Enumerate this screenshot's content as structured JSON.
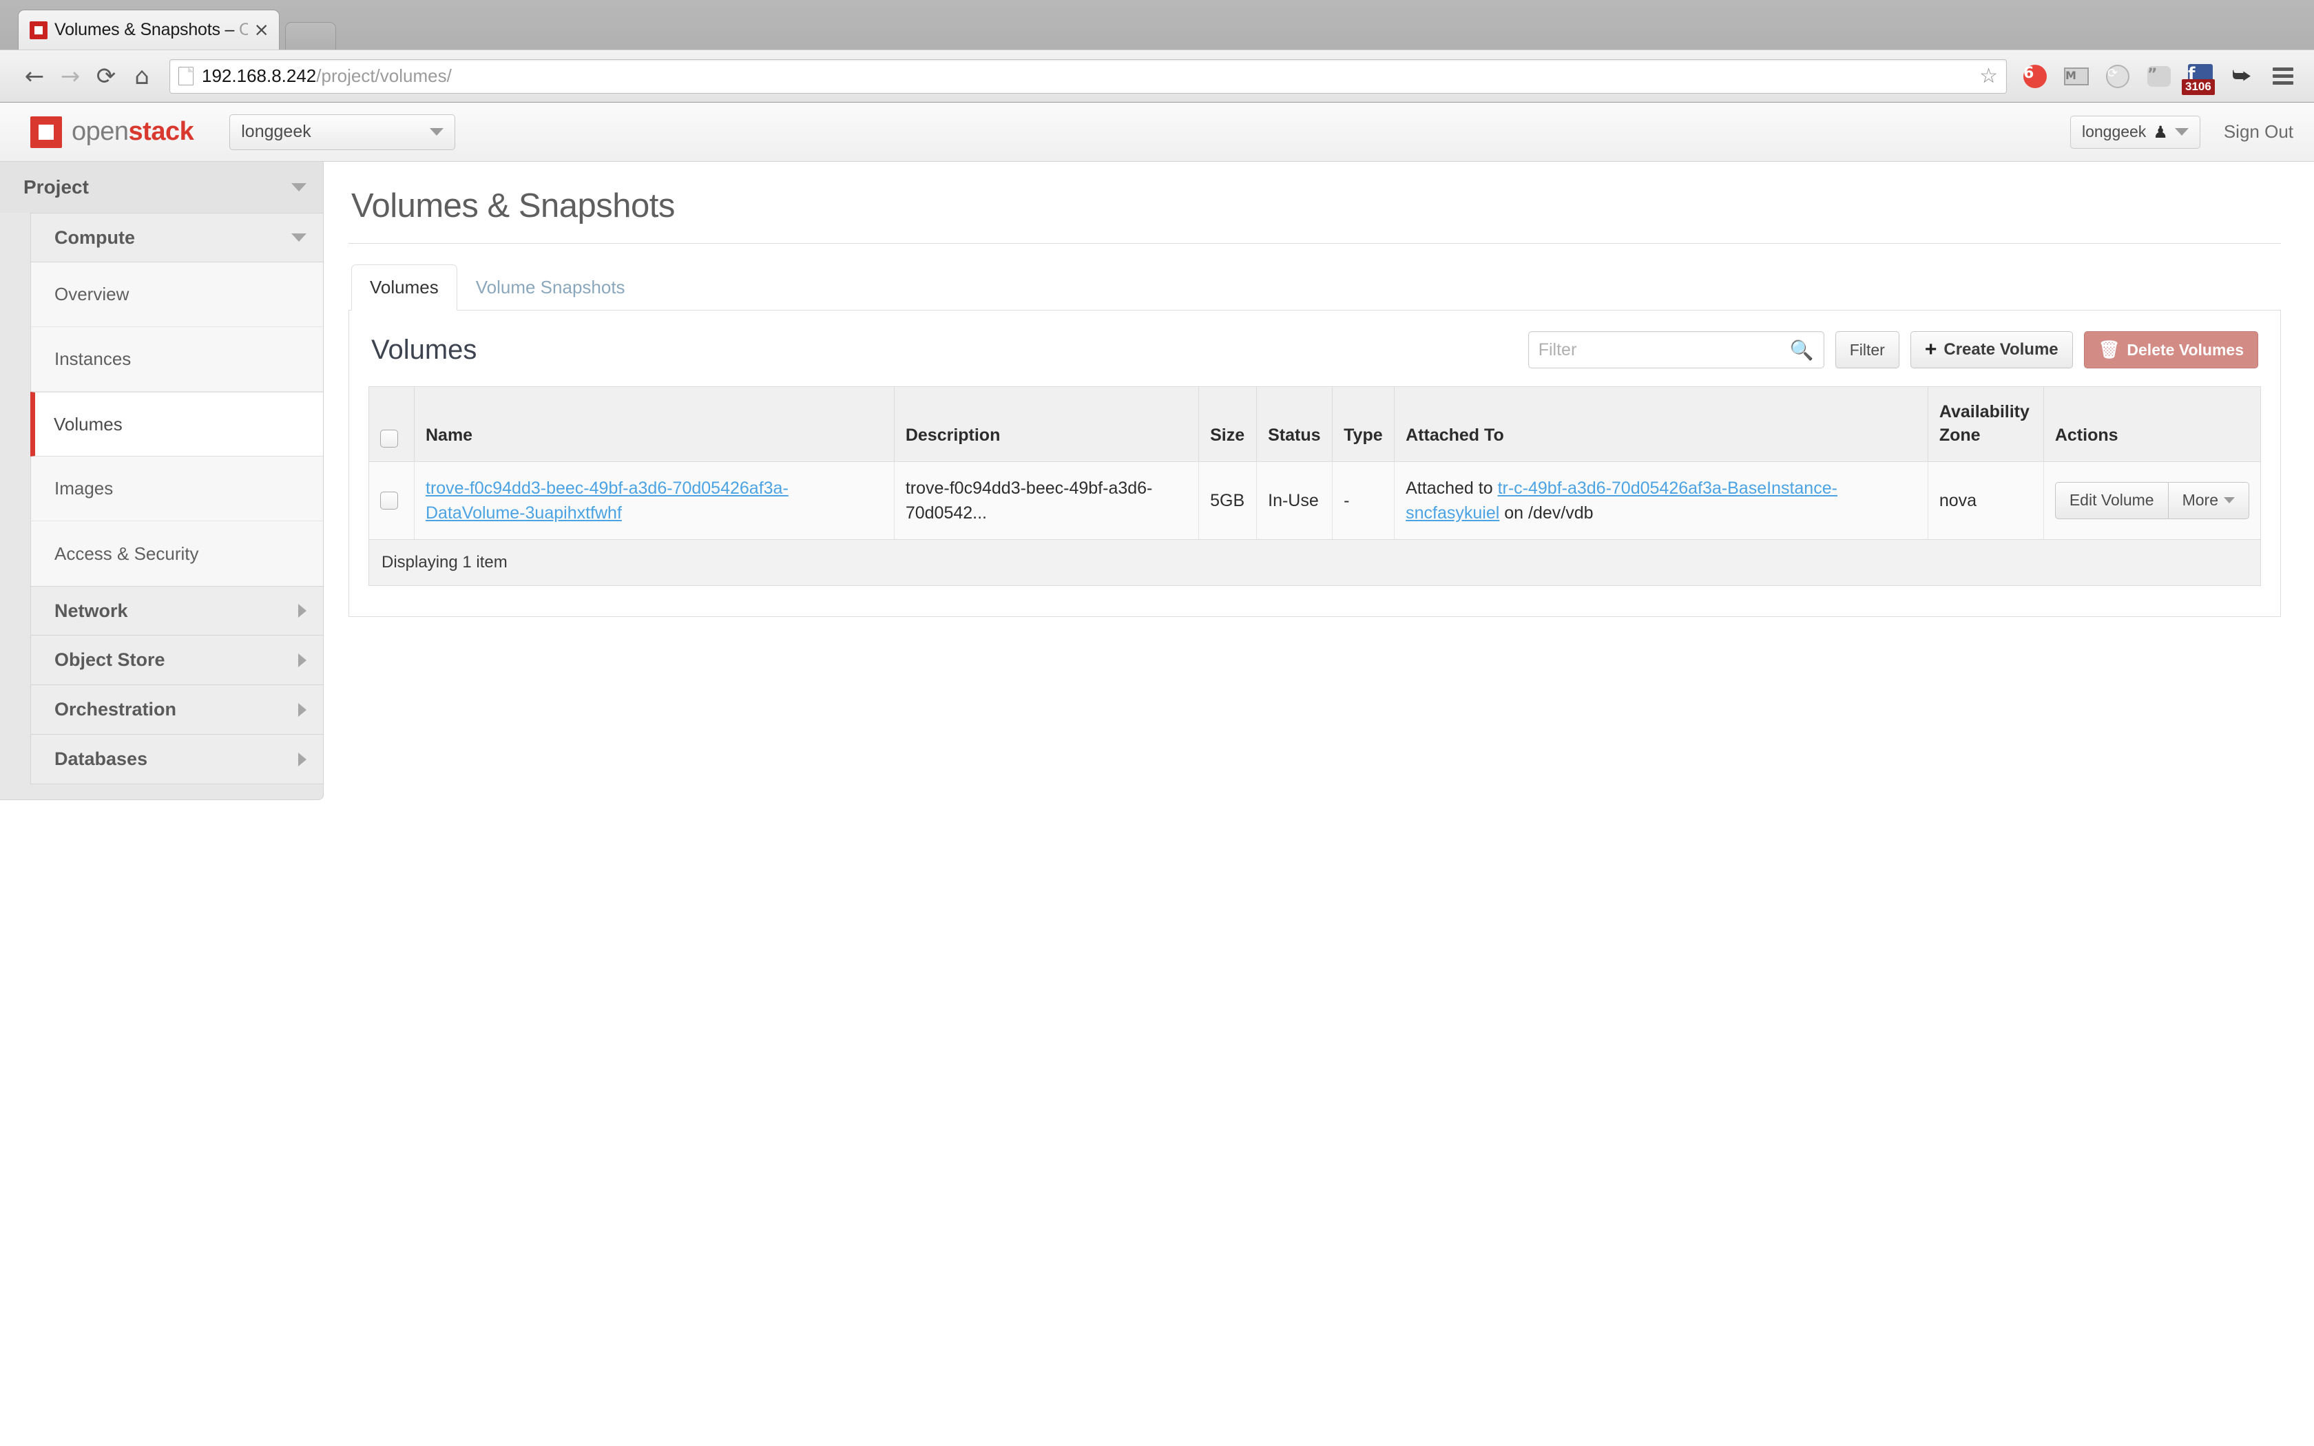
{
  "browser": {
    "tab_title_visible": "Volumes & Snapshots – ",
    "tab_title_fade": "Op",
    "close_label": "×",
    "back_glyph": "←",
    "forward_glyph": "→",
    "reload_glyph": "⟳",
    "home_glyph": "⌂",
    "url_host": "192.168.8.242",
    "url_path": "/project/volumes/",
    "star_glyph": "☆",
    "extensions": [
      {
        "name": "weibo-icon",
        "glyph": "6"
      },
      {
        "name": "gmail-icon",
        "glyph": "M"
      },
      {
        "name": "sync-globe-icon",
        "glyph": "⟳"
      },
      {
        "name": "hangouts-quote-icon",
        "glyph": "”"
      },
      {
        "name": "facebook-icon",
        "glyph": "f",
        "badge": "3106"
      },
      {
        "name": "download-arrow-icon",
        "glyph": "⮩"
      }
    ],
    "menu_label": "browser-menu"
  },
  "header": {
    "logo_open": "open",
    "logo_stack": "stack",
    "project_name": "longgeek",
    "user_name": "longgeek",
    "user_icon": "♟",
    "sign_out": "Sign Out"
  },
  "sidebar": {
    "top_group": "Project",
    "sections": [
      {
        "label": "Compute",
        "expanded": true,
        "items": [
          {
            "label": "Overview",
            "active": false
          },
          {
            "label": "Instances",
            "active": false
          },
          {
            "label": "Volumes",
            "active": true
          },
          {
            "label": "Images",
            "active": false
          },
          {
            "label": "Access & Security",
            "active": false
          }
        ]
      }
    ],
    "collapsed_sections": [
      {
        "label": "Network"
      },
      {
        "label": "Object Store"
      },
      {
        "label": "Orchestration"
      },
      {
        "label": "Databases"
      }
    ]
  },
  "main": {
    "page_title": "Volumes & Snapshots",
    "tabs": [
      {
        "label": "Volumes",
        "active": true
      },
      {
        "label": "Volume Snapshots",
        "active": false
      }
    ],
    "panel_title": "Volumes",
    "filter_placeholder": "Filter",
    "filter_value": "",
    "filter_button": "Filter",
    "create_button": "Create Volume",
    "delete_button": "Delete Volumes",
    "table": {
      "headers": {
        "name": "Name",
        "description": "Description",
        "size": "Size",
        "status": "Status",
        "type": "Type",
        "attached_to": "Attached To",
        "availability_zone_line1": "Availability",
        "availability_zone_line2": "Zone",
        "actions": "Actions"
      },
      "rows": [
        {
          "name": "trove-f0c94dd3-beec-49bf-a3d6-70d05426af3a-DataVolume-3uapihxtfwhf",
          "description": "trove-f0c94dd3-beec-49bf-a3d6-70d0542...",
          "size": "5GB",
          "status": "In-Use",
          "type": "-",
          "attached_prefix": "Attached to ",
          "attached_instance": "tr-c-49bf-a3d6-70d05426af3a-BaseInstance-sncfasykuiel",
          "attached_suffix": " on /dev/vdb",
          "availability_zone": "nova",
          "action_primary": "Edit Volume",
          "action_more": "More"
        }
      ],
      "footer": "Displaying 1 item"
    }
  },
  "colors": {
    "accent_red": "#d9382f",
    "link_blue": "#4ba3e3",
    "danger_bg": "#d28b85",
    "tab_inactive": "#8ba7bb"
  }
}
